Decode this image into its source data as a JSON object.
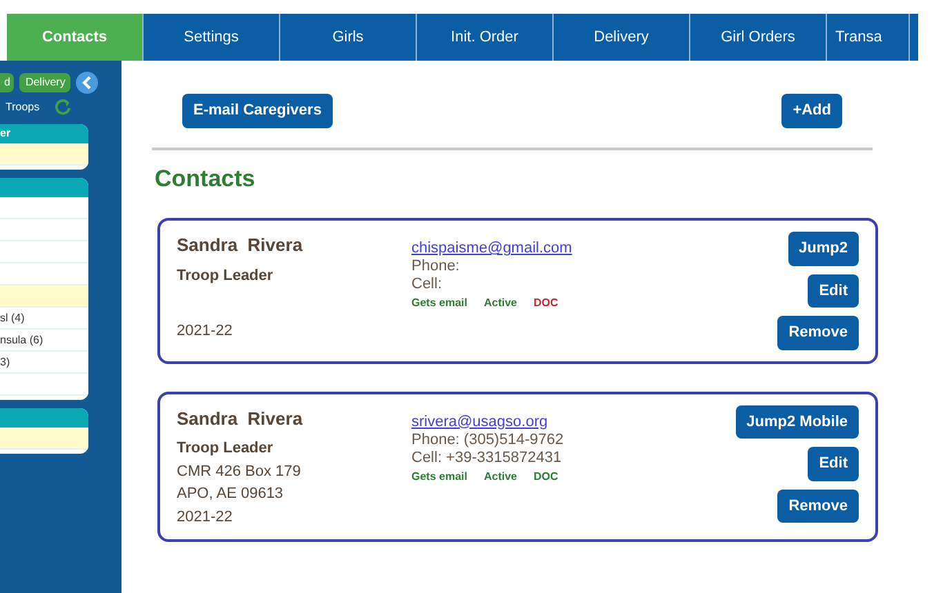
{
  "nav_tabs": [
    {
      "label": "Contacts",
      "selected": true
    },
    {
      "label": "Settings",
      "selected": false
    },
    {
      "label": "Girls",
      "selected": false
    },
    {
      "label": "Init. Order",
      "selected": false
    },
    {
      "label": "Delivery",
      "selected": false
    },
    {
      "label": "Girl Orders",
      "selected": false
    },
    {
      "label": "Transa",
      "selected": false
    }
  ],
  "sidebar": {
    "buttons": [
      "d",
      "Delivery"
    ],
    "troops_label": "Troops",
    "panels": [
      {
        "header": "er",
        "rows": [
          {
            "selected": true
          }
        ]
      },
      {
        "rows": [
          {
            "selected": false
          },
          {
            "selected": false
          },
          {
            "selected": false
          },
          {
            "selected": false
          },
          {
            "selected": true
          },
          {
            "text": "sl (4)",
            "selected": false
          },
          {
            "text": "nsula (6)",
            "selected": false
          },
          {
            "text": "3)",
            "selected": false
          },
          {
            "selected": false
          }
        ]
      },
      {
        "rows": [
          {
            "selected": true
          }
        ]
      }
    ]
  },
  "toolbar": {
    "email_button": "E-mail Caregivers",
    "add_button": "+Add"
  },
  "heading": "Contacts",
  "contacts": [
    {
      "name": "Sandra  Rivera",
      "role": "Troop Leader",
      "year": "2021-22",
      "email": "chispaisme@gmail.com",
      "phone": "Phone:",
      "cell": "Cell:",
      "tags": [
        {
          "label": "Gets email",
          "color": "#2e7d32"
        },
        {
          "label": "Active",
          "color": "#2e7d32"
        },
        {
          "label": "DOC",
          "color": "#c62828"
        }
      ],
      "buttons": [
        "Jump2",
        "Edit",
        "Remove"
      ]
    },
    {
      "name": "Sandra  Rivera",
      "role": "Troop Leader",
      "address": [
        "CMR 426 Box 179",
        "APO, AE 09613"
      ],
      "year": "2021-22",
      "email": "srivera@usagso.org",
      "phone": "Phone: (305)514-9762",
      "cell": "Cell: +39-3315872431",
      "tags": [
        {
          "label": "Gets email",
          "color": "#2e7d32"
        },
        {
          "label": "Active",
          "color": "#2e7d32"
        },
        {
          "label": "DOC",
          "color": "#2e7d32"
        }
      ],
      "buttons": [
        "Jump2 Mobile",
        "Edit",
        "Remove"
      ]
    }
  ]
}
